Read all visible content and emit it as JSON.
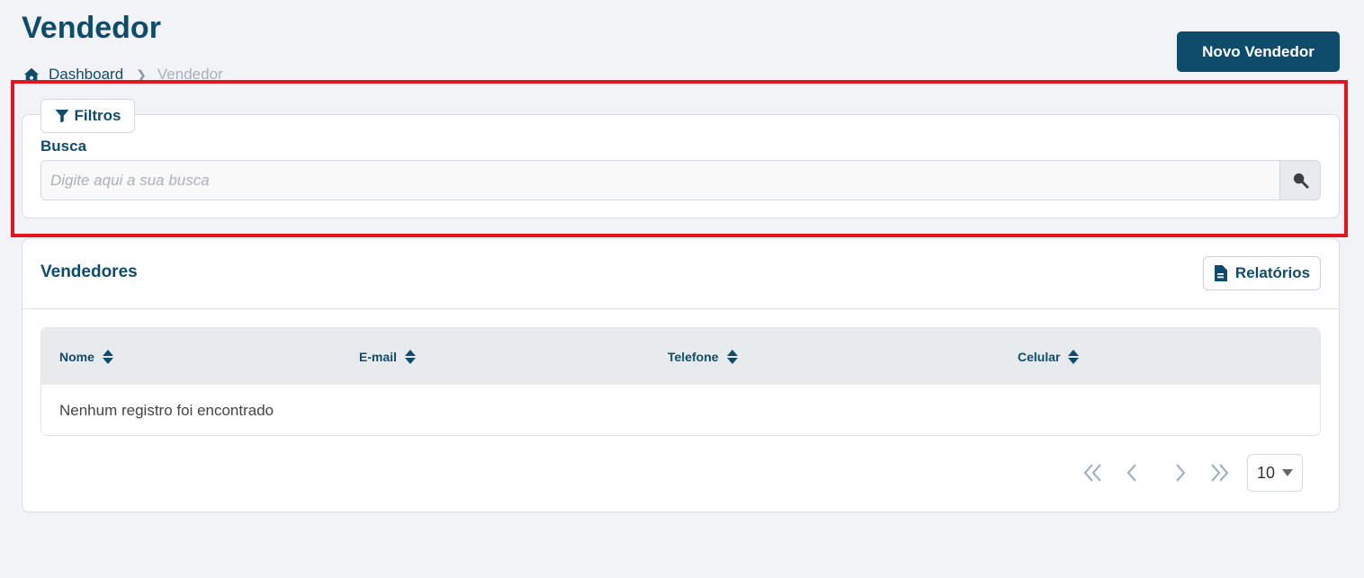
{
  "header": {
    "title": "Vendedor",
    "new_button_label": "Novo Vendedor"
  },
  "breadcrumb": {
    "items": [
      {
        "label": "Dashboard",
        "icon": "home-icon"
      },
      {
        "label": "Vendedor"
      }
    ]
  },
  "filters": {
    "tab_label": "Filtros",
    "search_label": "Busca",
    "search_placeholder": "Digite aqui a sua busca",
    "search_value": ""
  },
  "list": {
    "title": "Vendedores",
    "report_button_label": "Relatórios",
    "columns": [
      "Nome",
      "E-mail",
      "Telefone",
      "Celular"
    ],
    "empty_message": "Nenhum registro foi encontrado"
  },
  "pagination": {
    "page_size": "10"
  },
  "colors": {
    "primary": "#0f4c6b",
    "highlight": "#e3161f",
    "background": "#f2f3f7"
  }
}
